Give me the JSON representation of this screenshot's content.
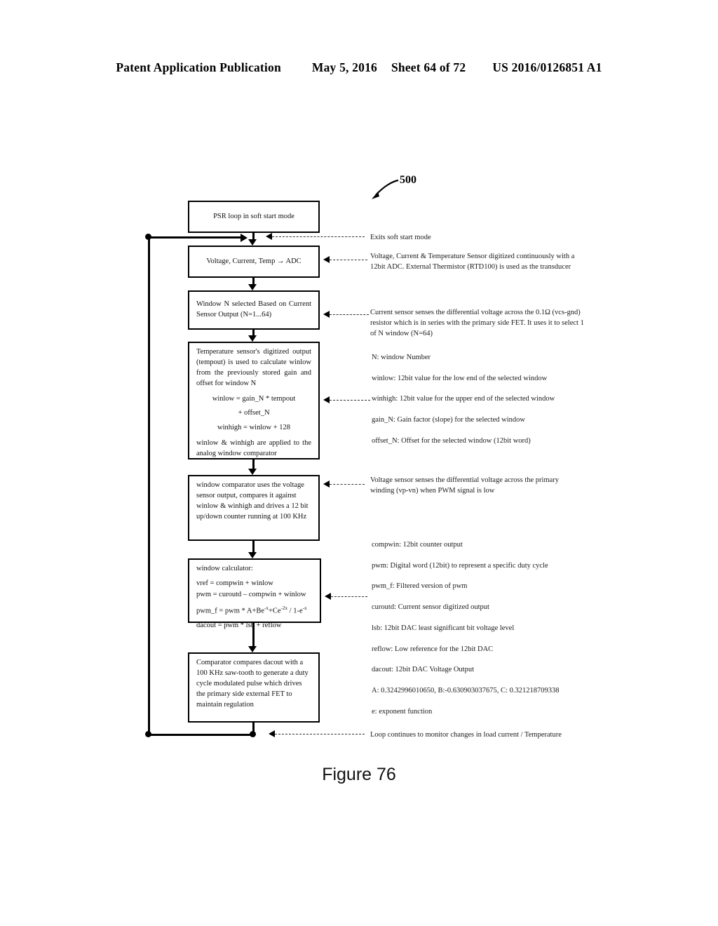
{
  "header": {
    "publication": "Patent Application Publication",
    "date": "May 5, 2016",
    "sheet": "Sheet 64 of 72",
    "number": "US 2016/0126851 A1"
  },
  "figure": {
    "reference_numeral": "500",
    "caption": "Figure 76"
  },
  "flow": {
    "boxes": [
      {
        "id": "psr",
        "lines": [
          "PSR loop in soft start mode"
        ]
      },
      {
        "id": "adc",
        "lines": [
          "Voltage, Current, Temp → ADC"
        ]
      },
      {
        "id": "window_select",
        "lines": [
          "Window N selected Based on Current Sensor Output (N=1...64)"
        ]
      },
      {
        "id": "temp_calc",
        "paragraph": "Temperature sensor's digitized output (tempout) is used to calculate winlow from the previously stored gain and offset for window N",
        "eq1": "winlow = gain_N * tempout",
        "eq2": "+ offset_N",
        "eq3": "winhigh = winlow + 128",
        "tail": "winlow & winhigh are applied to the analog window comparator"
      },
      {
        "id": "window_comparator",
        "paragraph": "window comparator uses the voltage sensor output, compares it against winlow & winhigh and drives a 12 bit up/down counter running at 100 KHz"
      },
      {
        "id": "window_calculator",
        "title": "window calculator:",
        "eq1": "vref = compwin + winlow",
        "eq2": "pwm = curoutd – compwin + winlow",
        "eq3_pre": "pwm_f = pwm * A+Be",
        "eq3_sup1": "-x",
        "eq3_mid": "+Ce",
        "eq3_sup2": "-2x",
        "eq3_post": " / 1-e",
        "eq3_sup3": "-x",
        "eq4": "dacout = pwm * lsb + reflow"
      },
      {
        "id": "final_comparator",
        "paragraph": "Comparator compares dacout with a 100 KHz saw-tooth to generate a duty cycle modulated pulse which drives the primary side external FET to maintain regulation"
      }
    ]
  },
  "annotations": {
    "exits_soft_start": "Exits soft start mode",
    "adc_note": "Voltage, Current & Temperature Sensor digitized continuously with a 12bit ADC. External Thermistor (RTD100) is used as the transducer",
    "current_sensor_note": "Current sensor senses the differential voltage across the 0.1Ω (vcs-gnd) resistor which is in series with the primary side FET. It uses it to select 1 of N window (N=64)",
    "voltage_sensor_note": "Voltage sensor senses the differential voltage across the primary winding (vp-vn) when PWM signal is low",
    "loop_note": "Loop continues to monitor changes in load current / Temperature"
  },
  "definitions": {
    "window_terms": [
      "N: window Number",
      "winlow: 12bit value for the low end of the selected window",
      "winhigh: 12bit value for the upper end of the selected window",
      "gain_N: Gain factor (slope) for the selected window",
      "offset_N: Offset for the selected window (12bit word)"
    ],
    "calculator_terms": [
      "compwin: 12bit counter output",
      "pwm: Digital word (12bit) to represent a specific duty cycle",
      "pwm_f: Filtered version of pwm",
      "curoutd: Current sensor digitized output",
      "lsb: 12bit DAC least significant bit voltage level",
      "reflow: Low reference for the 12bit DAC",
      "dacout: 12bit DAC Voltage Output",
      "A: 0.3242996010650, B:-0.630903037675, C: 0.321218709338",
      "e: exponent function"
    ]
  }
}
